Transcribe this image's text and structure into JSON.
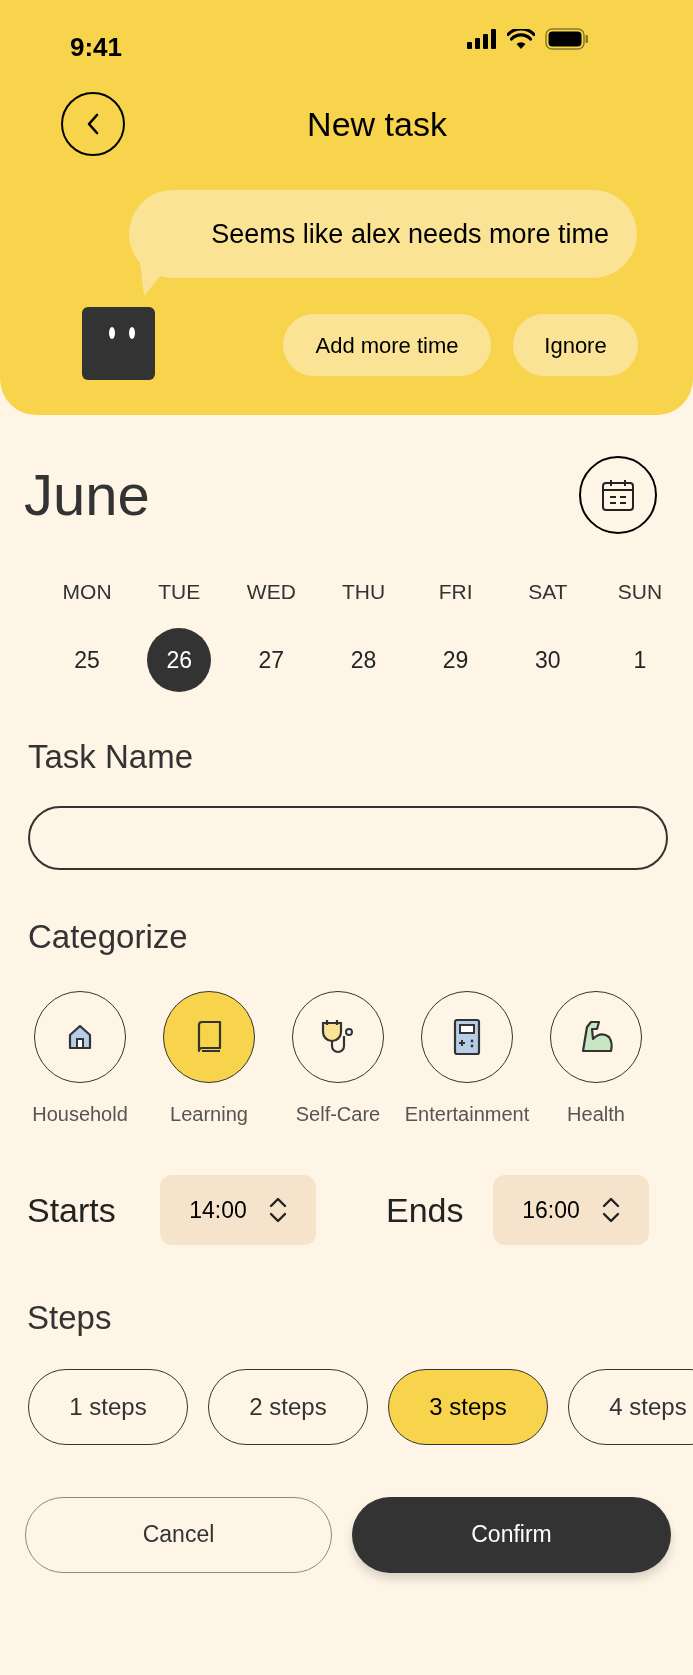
{
  "status_bar": {
    "time": "9:41"
  },
  "header": {
    "title": "New task",
    "message": "Seems like alex needs more time",
    "actions": [
      {
        "label": "Add more time"
      },
      {
        "label": "Ignore"
      }
    ]
  },
  "calendar": {
    "month": "June",
    "days": [
      {
        "weekday": "MON",
        "date": "25",
        "selected": false
      },
      {
        "weekday": "TUE",
        "date": "26",
        "selected": true
      },
      {
        "weekday": "WED",
        "date": "27",
        "selected": false
      },
      {
        "weekday": "THU",
        "date": "28",
        "selected": false
      },
      {
        "weekday": "FRI",
        "date": "29",
        "selected": false
      },
      {
        "weekday": "SAT",
        "date": "30",
        "selected": false
      },
      {
        "weekday": "SUN",
        "date": "1",
        "selected": false
      }
    ]
  },
  "task_name": {
    "label": "Task Name"
  },
  "categories": {
    "label": "Categorize",
    "items": [
      {
        "label": "Household",
        "kind": "house",
        "selected": false
      },
      {
        "label": "Learning",
        "kind": "book",
        "selected": true
      },
      {
        "label": "Self-Care",
        "kind": "stethoscope",
        "selected": false
      },
      {
        "label": "Entertainment",
        "kind": "console",
        "selected": false
      },
      {
        "label": "Health",
        "kind": "arm",
        "selected": false
      }
    ]
  },
  "time": {
    "start_label": "Starts",
    "start": "14:00",
    "end_label": "Ends",
    "end": "16:00"
  },
  "steps": {
    "label": "Steps",
    "items": [
      {
        "label": "1 steps",
        "selected": false
      },
      {
        "label": "2 steps",
        "selected": false
      },
      {
        "label": "3 steps",
        "selected": true
      },
      {
        "label": "4 steps",
        "selected": false
      }
    ]
  },
  "buttons": [
    {
      "label": "Cancel",
      "kind": "secondary"
    },
    {
      "label": "Confirm",
      "kind": "primary"
    }
  ]
}
